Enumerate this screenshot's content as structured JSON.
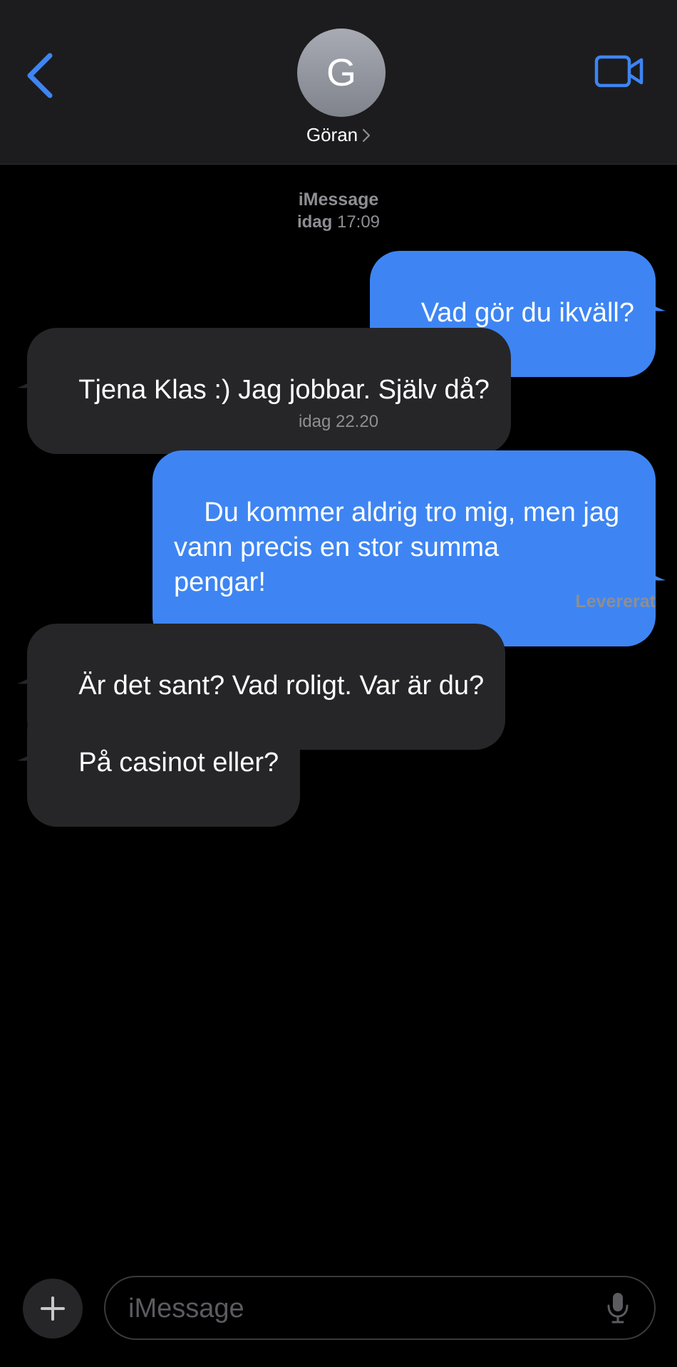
{
  "header": {
    "avatar_initial": "G",
    "contact_name": "Göran"
  },
  "conversation": {
    "service_label": "iMessage",
    "timestamps": [
      {
        "day": "idag",
        "time": "17:09"
      },
      {
        "day": "idag",
        "time": "22.20"
      }
    ],
    "messages": [
      {
        "direction": "outgoing",
        "text": "Vad gör du ikväll?"
      },
      {
        "direction": "incoming",
        "text": "Tjena Klas :) Jag jobbar. Själv då?"
      },
      {
        "direction": "outgoing",
        "text": "Du kommer aldrig tro mig, men jag\nvann precis en stor summa\npengar!"
      },
      {
        "direction": "incoming",
        "text": "Är det sant? Vad roligt. Var är du?"
      },
      {
        "direction": "incoming",
        "text": "På casinot eller?"
      }
    ],
    "delivered_status": "Levererat"
  },
  "composer": {
    "placeholder": "iMessage"
  },
  "icons": {
    "back": "chevron-left-icon",
    "name_disclosure": "chevron-right-icon",
    "video": "video-camera-icon",
    "plus": "plus-icon",
    "mic": "microphone-icon"
  },
  "colors": {
    "accent": "#3e85f3",
    "outgoing_bubble": "#3e85f3",
    "incoming_bubble": "#262628",
    "header_bg": "#1c1c1e",
    "background": "#000000",
    "secondary_text": "#8e8e93"
  }
}
